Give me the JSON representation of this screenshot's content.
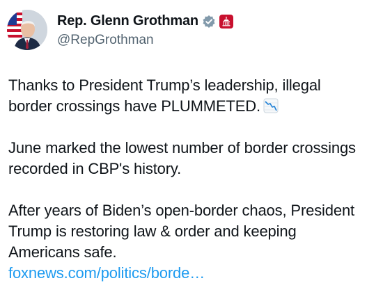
{
  "author": {
    "display_name": "Rep. Glenn Grothman",
    "handle": "@RepGrothman",
    "verified_badge": "verified-check-icon",
    "affiliation_badge": "capitol-icon",
    "badge_color": "#829aab",
    "affiliation_color": "#c8102e"
  },
  "tweet": {
    "p1_line1": "Thanks to President Trump’s leadership, illegal",
    "p1_line2": "border crossings have PLUMMETED.",
    "p1_emoji": "chart-decreasing-icon",
    "p2_line1": "June marked the lowest number of border crossings",
    "p2_line2": "recorded in CBP's history.",
    "p3_line1": "After years of Biden’s open-border chaos, President",
    "p3_line2": "Trump is restoring law & order and keeping",
    "p3_line3": "Americans safe.",
    "link_text": "foxnews.com/politics/borde…",
    "link_color": "#1d9bf0",
    "text_color": "#0f1419",
    "secondary_color": "#536471"
  }
}
